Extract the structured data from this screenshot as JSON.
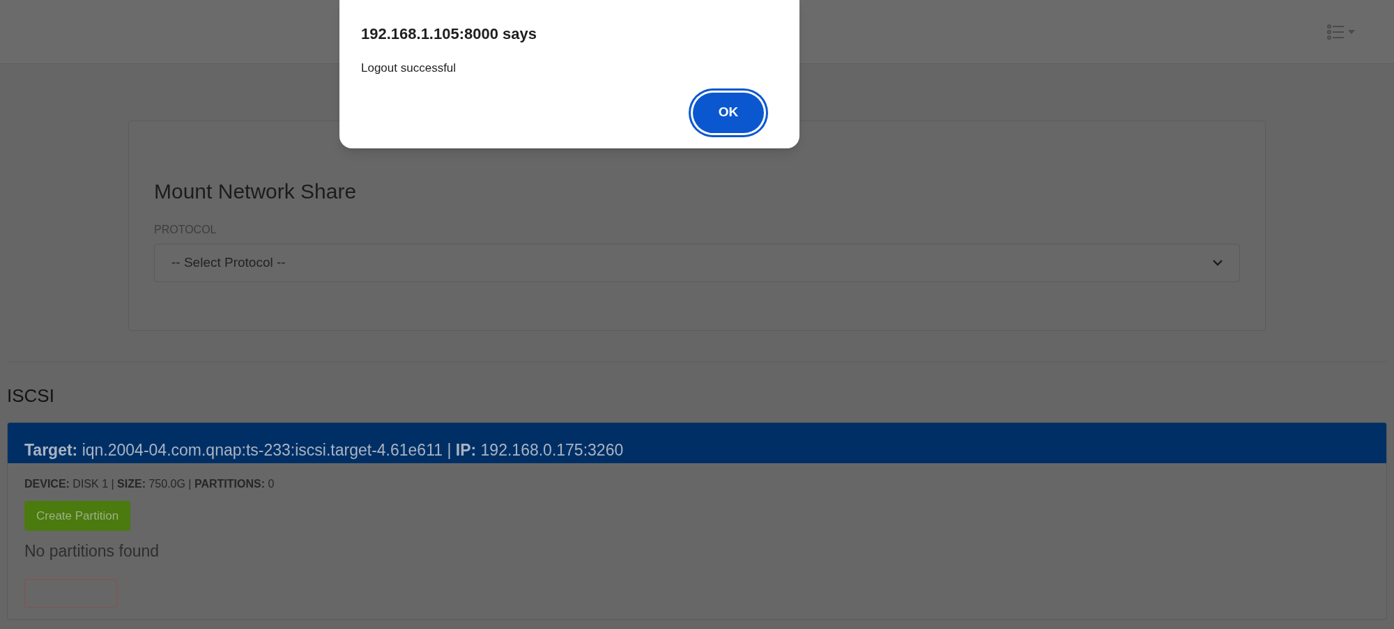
{
  "dialog": {
    "title": "192.168.1.105:8000 says",
    "message": "Logout successful",
    "button": "OK"
  },
  "mount_form": {
    "title": "Mount Network Share",
    "protocol_label": "PROTOCOL",
    "protocol_select": "-- Select Protocol --"
  },
  "iscsi": {
    "heading": "ISCSI",
    "targets": [
      {
        "header": "**Target:** iqn.2004-04.com.qnap:ts-233:iscsi.target-4.61e611 | **IP:** 192.168.0.175:3260",
        "device": "**DEVICE:** DISK 1 | **SIZE:** 750.0G | **PARTITIONS:** 0",
        "action": "Create Partition",
        "empty_message": "No partitions found"
      }
    ]
  }
}
